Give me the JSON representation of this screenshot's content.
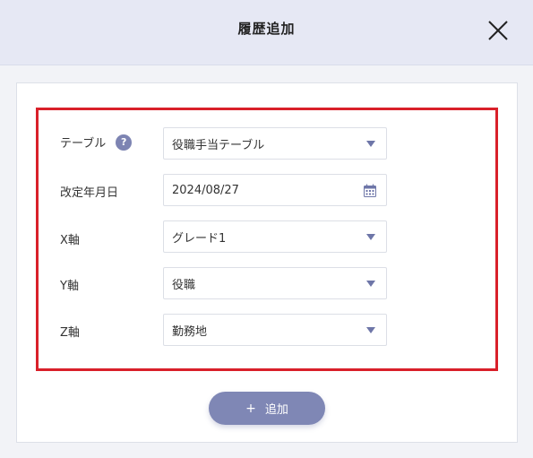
{
  "dialog": {
    "title": "履歴追加"
  },
  "form": {
    "table": {
      "label": "テーブル",
      "help": "?",
      "value": "役職手当テーブル"
    },
    "revision_date": {
      "label": "改定年月日",
      "value": "2024/08/27"
    },
    "x_axis": {
      "label": "X軸",
      "value": "グレード1"
    },
    "y_axis": {
      "label": "Y軸",
      "value": "役職"
    },
    "z_axis": {
      "label": "Z軸",
      "value": "勤務地"
    }
  },
  "actions": {
    "add_plus": "+",
    "add_label": "追加"
  },
  "colors": {
    "header_bg": "#e6e8f4",
    "accent": "#7f87b5",
    "highlight": "#d9202a"
  }
}
